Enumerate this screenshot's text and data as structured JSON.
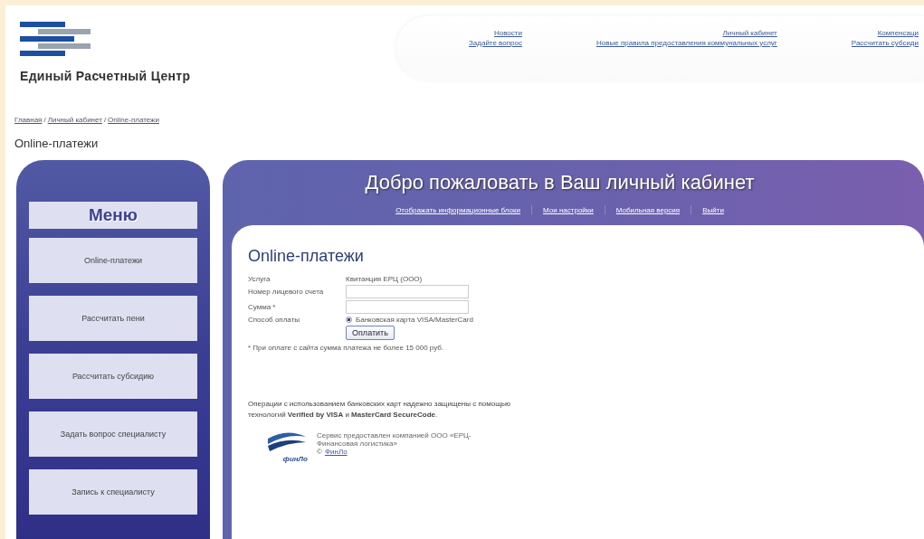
{
  "header": {
    "site_title": "Единый Расчетный Центр",
    "nav": [
      {
        "top": "Новости",
        "bottom": "Задайте вопрос"
      },
      {
        "top": "Личный кабинет",
        "bottom": "Новые правила предоставления коммунальных услуг"
      },
      {
        "top": "Компенсаци",
        "bottom": "Рассчитать субсиди"
      }
    ]
  },
  "breadcrumbs": {
    "separator": "/",
    "items": [
      "Главная",
      "Личный кабинет",
      "Online-платежи"
    ]
  },
  "page_title": "Online-платежи",
  "sidebar": {
    "title": "Меню",
    "items": [
      {
        "label": "Online-платежи"
      },
      {
        "label": "Рассчитать пени"
      },
      {
        "label": "Рассчитать субсидию"
      },
      {
        "label": "Задать вопрос специалисту"
      },
      {
        "label": "Запись к специалисту"
      }
    ]
  },
  "cabinet": {
    "welcome": "Добро пожаловать в Ваш личный кабинет",
    "links": [
      "Отображать информационные блоки",
      "Мои настройки",
      "Мобильная версия",
      "Выйти"
    ],
    "form": {
      "title": "Online-платежи",
      "rows": [
        {
          "kind": "text",
          "label": "Услуга",
          "value": "Квитанция ЕРЦ (ООО)"
        },
        {
          "kind": "input",
          "label": "Номер лицевого счета"
        },
        {
          "kind": "input",
          "label": "Сумма *"
        },
        {
          "kind": "radio",
          "label": "Способ оплаты",
          "option": "Банковская карта VISA/MasterCard",
          "selected": true
        }
      ],
      "submit": "Оплатить",
      "note": "* При оплате с сайта сумма платежа не более 15 000 руб."
    },
    "security_note": "Операции с использованием банковских карт надежно защищены с помощью технологий **Verified by VISA** и **MasterCard SecureCode**.",
    "footer": {
      "logo_text": "финЛо",
      "service": "Сервис предоставлен компанией ООО «ЕРЦ-Финансовая логистика»",
      "copyright": "©",
      "link": "ФинЛо"
    }
  }
}
